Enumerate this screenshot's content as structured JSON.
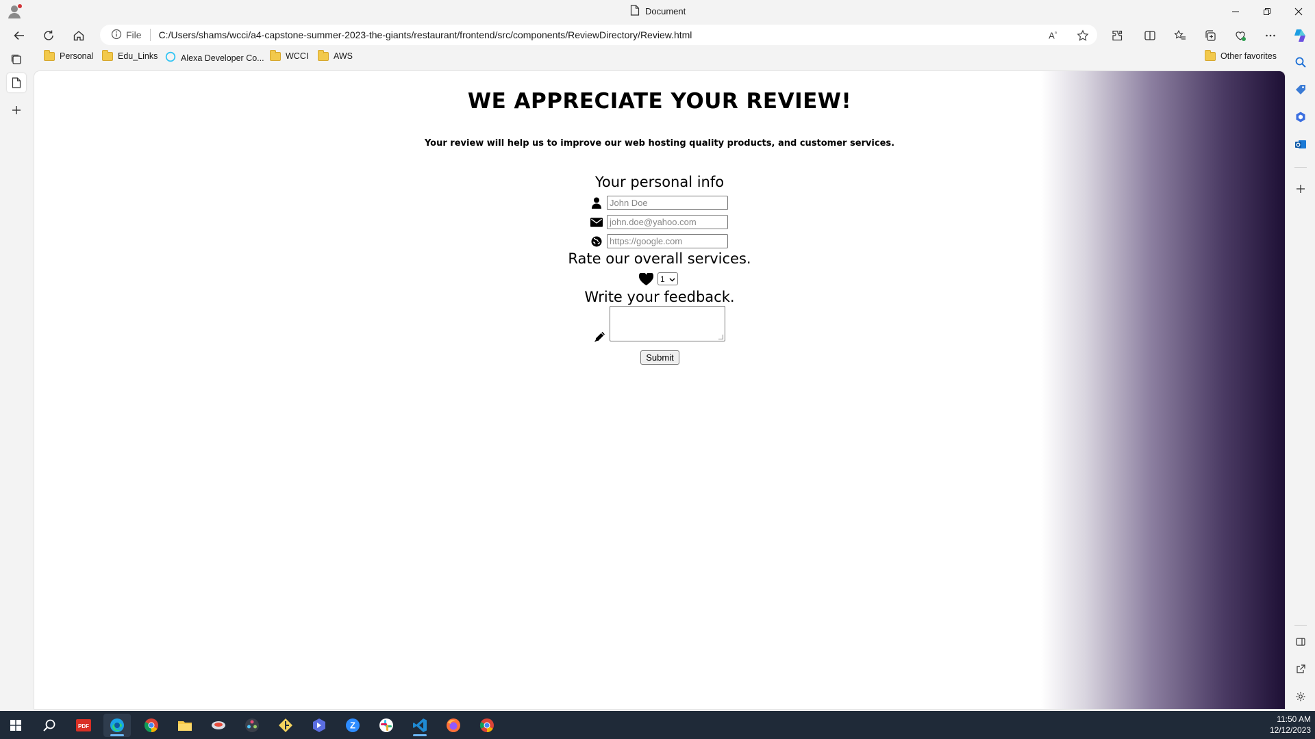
{
  "browser": {
    "tab_title": "Document",
    "url_scheme_label": "File",
    "url": "C:/Users/shams/wcci/a4-capstone-summer-2023-the-giants/restaurant/frontend/src/components/ReviewDirectory/Review.html",
    "favorites": [
      {
        "label": "Personal",
        "icon": "folder-icon"
      },
      {
        "label": "Edu_Links",
        "icon": "folder-icon"
      },
      {
        "label": "Alexa Developer Co...",
        "icon": "alexa-icon"
      },
      {
        "label": "WCCI",
        "icon": "folder-icon"
      },
      {
        "label": "AWS",
        "icon": "folder-icon"
      }
    ],
    "other_favorites": "Other favorites"
  },
  "page": {
    "title": "WE APPRECIATE YOUR REVIEW!",
    "subtitle": "Your review will help us to improve our web hosting quality products, and customer services.",
    "personal_info_heading": "Your personal info",
    "name_placeholder": "John Doe",
    "email_placeholder": "john.doe@yahoo.com",
    "website_placeholder": "https://google.com",
    "rating_heading": "Rate our overall services.",
    "rating_value": "1",
    "feedback_heading": "Write your feedback.",
    "submit_label": "Submit",
    "gradient_colors": [
      "#ffffff",
      "#8c7fa0",
      "#1e1035"
    ]
  },
  "taskbar": {
    "time": "11:50 AM",
    "date": "12/12/2023",
    "apps": [
      "start-icon",
      "search-icon",
      "pdf-icon",
      "edge-icon",
      "chrome-icon",
      "file-explorer-icon",
      "app-icon",
      "davinci-icon",
      "git-icon",
      "app-icon",
      "zoom-icon",
      "slack-icon",
      "vscode-icon",
      "firefox-icon",
      "chrome-icon"
    ]
  }
}
